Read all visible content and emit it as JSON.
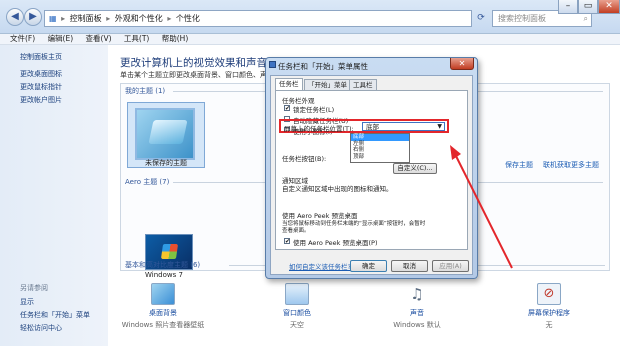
{
  "titlebar": {
    "breadcrumb": [
      "控制面板",
      "外观和个性化",
      "个性化"
    ],
    "search_placeholder": "搜索控制面板",
    "controls": {
      "minimize": "–",
      "maximize": "▭",
      "close": "✕"
    }
  },
  "menubar": {
    "items": [
      "文件(F)",
      "编辑(E)",
      "查看(V)",
      "工具(T)",
      "帮助(H)"
    ]
  },
  "sidebar": {
    "home": "控制面板主页",
    "links": [
      "更改桌面图标",
      "更改鼠标指针",
      "更改帐户图片"
    ],
    "see_also_title": "另请参阅",
    "see_also": [
      "显示",
      "任务栏和「开始」菜单",
      "轻松访问中心"
    ]
  },
  "main": {
    "title": "更改计算机上的视觉效果和声音",
    "description": "单击某个主题立即更改桌面背景、窗口颜色、声音和",
    "my_themes": "我的主题 (1)",
    "saved_theme_label": "未保存的主题",
    "save_theme": "保存主题",
    "get_more": "联机获取更多主题",
    "aero_themes": "Aero 主题 (7)",
    "win7_label": "Windows 7",
    "basic_themes": "基本和高对比度主题 (6)"
  },
  "bottom": [
    {
      "name": "桌面背景",
      "sub": "Windows 照片查看器壁纸",
      "icon": "desktop-background-icon",
      "color": "#3b8fd6"
    },
    {
      "name": "窗口颜色",
      "sub": "天空",
      "icon": "window-color-icon",
      "color": "#9fc8ee"
    },
    {
      "name": "声音",
      "sub": "Windows 默认",
      "icon": "sound-icon",
      "color": "#5a6b80"
    },
    {
      "name": "屏幕保护程序",
      "sub": "无",
      "icon": "screensaver-icon",
      "color": "#c0392b"
    }
  ],
  "dialog": {
    "title": "任务栏和「开始」菜单属性",
    "close": "✕",
    "tabs": [
      "任务栏",
      "「开始」菜单",
      "工具栏"
    ],
    "appearance_label": "任务栏外观",
    "checkboxes": [
      {
        "label": "锁定任务栏(L)",
        "checked": true,
        "mark": "✔"
      },
      {
        "label": "自动隐藏任务栏(U)",
        "checked": false,
        "mark": ""
      },
      {
        "label": "使用小图标(I)",
        "checked": false,
        "mark": ""
      }
    ],
    "position_label": "屏幕上的任务栏位置(T):",
    "position_value": "底部",
    "position_options": [
      "底部",
      "左侧",
      "右侧",
      "顶部"
    ],
    "buttons_label": "任务栏按钮(B):",
    "notification_title": "通知区域",
    "notification_desc": "自定义通知区域中出现的图标和通知。",
    "customize": "自定义(C)...",
    "aero_peek_title": "使用 Aero Peek 预览桌面",
    "aero_peek_desc_1": "当您将鼠标移动到任务栏末端的“显示桌面”按钮时，会暂时",
    "aero_peek_desc_2": "查看桌面。",
    "aero_peek_checkbox": "使用 Aero Peek 预览桌面(P)",
    "aero_peek_mark": "✔",
    "help_link": "如何自定义该任务栏?",
    "ok": "确定",
    "cancel": "取消",
    "apply": "应用(A)"
  },
  "colors": {
    "highlight": "#e3262b",
    "link": "#1a5bb3",
    "select": "#3399ff"
  }
}
